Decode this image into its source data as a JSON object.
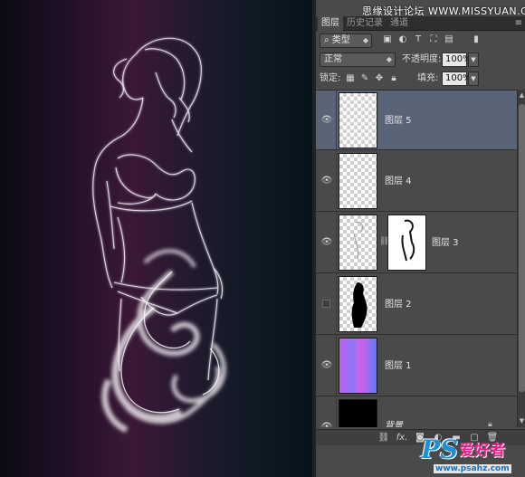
{
  "watermark_top": "思缘设计论坛 WWW.MISSYUAN.COM",
  "tabs": [
    {
      "label": "图层",
      "active": true
    },
    {
      "label": "历史记录",
      "active": false
    },
    {
      "label": "通道",
      "active": false
    }
  ],
  "panel_menu_icon": "≡",
  "filter": {
    "kind_label": "类型",
    "icons": [
      "image-filter-icon",
      "adjustment-filter-icon",
      "type-filter-icon",
      "shape-filter-icon",
      "smart-object-filter-icon",
      "toggle-filter-icon"
    ]
  },
  "blend": {
    "mode": "正常",
    "opacity_label": "不透明度:",
    "opacity_value": "100%"
  },
  "lock": {
    "label": "锁定:",
    "fill_label": "填充:",
    "fill_value": "100%"
  },
  "layers": [
    {
      "name": "图层 5",
      "visible": true,
      "selected": true
    },
    {
      "name": "图层 4",
      "visible": true,
      "selected": false
    },
    {
      "name": "图层 3",
      "visible": true,
      "selected": false,
      "has_mask": true
    },
    {
      "name": "图层 2",
      "visible": false,
      "selected": false
    },
    {
      "name": "图层 1",
      "visible": true,
      "selected": false
    },
    {
      "name": "背景",
      "visible": true,
      "selected": false,
      "locked": true
    }
  ],
  "bottom_icons": [
    "link-layers-icon",
    "fx-icon",
    "add-mask-icon",
    "adjustment-layer-icon",
    "group-folder-icon",
    "new-layer-icon",
    "trash-icon"
  ],
  "fx_label": "fx.",
  "watermark_bottom": {
    "ps": "PS",
    "cn": "爱好者",
    "url": "www.psahz.com"
  },
  "colors": {
    "selected_row": "#596476",
    "panel_bg": "#4a4a4a",
    "wm_blue": "#1f8fd6",
    "wm_pink": "#e0218a"
  }
}
